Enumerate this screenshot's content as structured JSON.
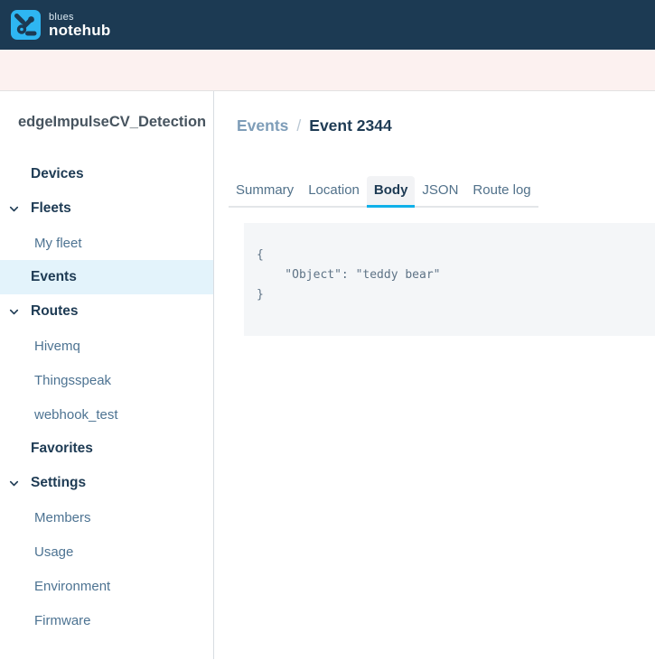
{
  "header": {
    "brand_top": "blues",
    "brand_bottom": "notehub"
  },
  "sidebar": {
    "project_title": "edgeImpulseCV_Detection",
    "items": [
      {
        "label": "Devices",
        "type": "top",
        "chevron": false,
        "active": false
      },
      {
        "label": "Fleets",
        "type": "top",
        "chevron": true,
        "active": false
      },
      {
        "label": "My fleet",
        "type": "sub",
        "chevron": false,
        "active": false
      },
      {
        "label": "Events",
        "type": "top",
        "chevron": false,
        "active": true
      },
      {
        "label": "Routes",
        "type": "top",
        "chevron": true,
        "active": false
      },
      {
        "label": "Hivemq",
        "type": "sub",
        "chevron": false,
        "active": false
      },
      {
        "label": "Thingsspeak",
        "type": "sub",
        "chevron": false,
        "active": false
      },
      {
        "label": "webhook_test",
        "type": "sub",
        "chevron": false,
        "active": false
      },
      {
        "label": "Favorites",
        "type": "top",
        "chevron": false,
        "active": false
      },
      {
        "label": "Settings",
        "type": "top",
        "chevron": true,
        "active": false
      },
      {
        "label": "Members",
        "type": "sub",
        "chevron": false,
        "active": false
      },
      {
        "label": "Usage",
        "type": "sub",
        "chevron": false,
        "active": false
      },
      {
        "label": "Environment",
        "type": "sub",
        "chevron": false,
        "active": false
      },
      {
        "label": "Firmware",
        "type": "sub",
        "chevron": false,
        "active": false
      }
    ]
  },
  "breadcrumb": {
    "parent": "Events",
    "separator": "/",
    "current": "Event 2344"
  },
  "tabs": [
    {
      "label": "Summary",
      "active": false
    },
    {
      "label": "Location",
      "active": false
    },
    {
      "label": "Body",
      "active": true
    },
    {
      "label": "JSON",
      "active": false
    },
    {
      "label": "Route log",
      "active": false
    }
  ],
  "event_body": {
    "lines": [
      "{",
      "    \"Object\": \"teddy bear\"",
      "}"
    ]
  },
  "colors": {
    "header_bg": "#1c3a53",
    "logo_blue": "#2eb6f2",
    "notification_band": "#fcf1f0",
    "accent_underline": "#0fb0e9",
    "active_item_bg": "#e3f3fb",
    "breadcrumb_link": "#7e9db8",
    "text_dark": "#1e3b54",
    "text_sub": "#4d7392",
    "code_bg": "#f4f6f8",
    "code_text": "#5e7386"
  }
}
